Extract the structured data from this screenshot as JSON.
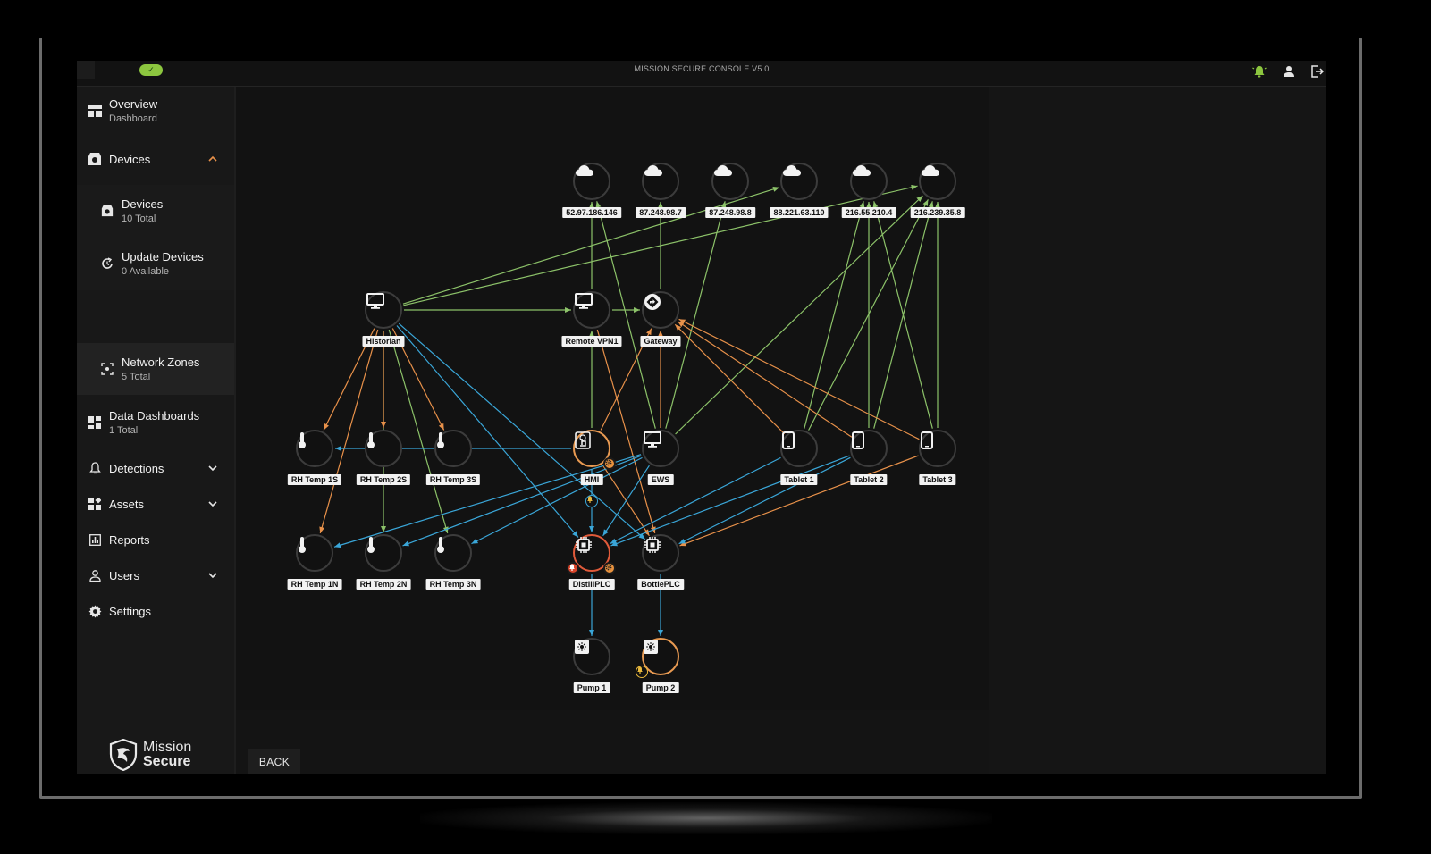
{
  "header": {
    "title": "MISSION SECURE CONSOLE V5.0",
    "status_check": "✓"
  },
  "sidebar": {
    "items": [
      {
        "label": "Overview",
        "sub": "Dashboard",
        "icon": "dashboard-icon"
      },
      {
        "label": "Devices",
        "sub": "",
        "icon": "device-icon",
        "expanded": true
      },
      {
        "label": "Devices",
        "sub": "10 Total",
        "icon": "device-icon"
      },
      {
        "label": "Update Devices",
        "sub": "0 Available",
        "icon": "refresh-icon"
      },
      {
        "label": "Network Zones",
        "sub": "5 Total",
        "icon": "zone-icon",
        "active": true
      },
      {
        "label": "Data Dashboards",
        "sub": "1 Total",
        "icon": "grid-icon"
      },
      {
        "label": "Detections",
        "sub": "",
        "icon": "bell-icon"
      },
      {
        "label": "Assets",
        "sub": "",
        "icon": "assets-icon"
      },
      {
        "label": "Reports",
        "sub": "",
        "icon": "reports-icon"
      },
      {
        "label": "Users",
        "sub": "",
        "icon": "user-icon"
      },
      {
        "label": "Settings",
        "sub": "",
        "icon": "gear-icon"
      }
    ],
    "logo": {
      "line1": "Mission",
      "line2": "Secure"
    }
  },
  "footer": {
    "back_label": "BACK"
  },
  "colors": {
    "green_edge": "#8cc269",
    "orange_edge": "#e8914a",
    "blue_edge": "#3aa6d8",
    "alert_red": "#e05a3a",
    "warn_orange": "#e89a52"
  },
  "network": {
    "nodes": [
      {
        "id": "c1",
        "label": "52.97.186.146",
        "type": "cloud"
      },
      {
        "id": "c2",
        "label": "87.248.98.7",
        "type": "cloud"
      },
      {
        "id": "c3",
        "label": "87.248.98.8",
        "type": "cloud"
      },
      {
        "id": "c4",
        "label": "88.221.63.110",
        "type": "cloud"
      },
      {
        "id": "c5",
        "label": "216.55.210.4",
        "type": "cloud"
      },
      {
        "id": "c6",
        "label": "216.239.35.8",
        "type": "cloud"
      },
      {
        "id": "hist",
        "label": "Historian",
        "type": "monitor"
      },
      {
        "id": "vpn",
        "label": "Remote VPN1",
        "type": "monitor"
      },
      {
        "id": "gw",
        "label": "Gateway",
        "type": "gateway"
      },
      {
        "id": "t1s",
        "label": "RH Temp 1S",
        "type": "thermo"
      },
      {
        "id": "t2s",
        "label": "RH Temp 2S",
        "type": "thermo"
      },
      {
        "id": "t3s",
        "label": "RH Temp 3S",
        "type": "thermo"
      },
      {
        "id": "hmi",
        "label": "HMI",
        "type": "touch",
        "status": "warn"
      },
      {
        "id": "ews",
        "label": "EWS",
        "type": "monitor"
      },
      {
        "id": "tab1",
        "label": "Tablet 1",
        "type": "tablet"
      },
      {
        "id": "tab2",
        "label": "Tablet 2",
        "type": "tablet"
      },
      {
        "id": "tab3",
        "label": "Tablet 3",
        "type": "tablet"
      },
      {
        "id": "t1n",
        "label": "RH Temp 1N",
        "type": "thermo"
      },
      {
        "id": "t2n",
        "label": "RH Temp 2N",
        "type": "thermo"
      },
      {
        "id": "t3n",
        "label": "RH Temp 3N",
        "type": "thermo"
      },
      {
        "id": "dplc",
        "label": "DistillPLC",
        "type": "chip",
        "status": "alert"
      },
      {
        "id": "bplc",
        "label": "BottlePLC",
        "type": "chip"
      },
      {
        "id": "p1",
        "label": "Pump 1",
        "type": "pump"
      },
      {
        "id": "p2",
        "label": "Pump 2",
        "type": "pump",
        "status": "warn"
      }
    ],
    "edges": [
      {
        "from": "hist",
        "to": "c4",
        "color": "green"
      },
      {
        "from": "hist",
        "to": "c6",
        "color": "green"
      },
      {
        "from": "hist",
        "to": "vpn",
        "color": "green"
      },
      {
        "from": "vpn",
        "to": "gw",
        "color": "green"
      },
      {
        "from": "vpn",
        "to": "c1",
        "color": "green"
      },
      {
        "from": "gw",
        "to": "c2",
        "color": "green"
      },
      {
        "from": "hmi",
        "to": "vpn",
        "color": "green"
      },
      {
        "from": "ews",
        "to": "c1",
        "color": "green"
      },
      {
        "from": "ews",
        "to": "c3",
        "color": "green"
      },
      {
        "from": "ews",
        "to": "c6",
        "color": "green"
      },
      {
        "from": "tab1",
        "to": "c5",
        "color": "green"
      },
      {
        "from": "tab1",
        "to": "c6",
        "color": "green"
      },
      {
        "from": "tab2",
        "to": "c5",
        "color": "green"
      },
      {
        "from": "tab2",
        "to": "c6",
        "color": "green"
      },
      {
        "from": "tab3",
        "to": "c5",
        "color": "green"
      },
      {
        "from": "tab3",
        "to": "c6",
        "color": "green"
      },
      {
        "from": "hist",
        "to": "t2n",
        "color": "green"
      },
      {
        "from": "hist",
        "to": "t3n",
        "color": "green"
      },
      {
        "from": "hmi",
        "to": "gw",
        "color": "orange"
      },
      {
        "from": "ews",
        "to": "gw",
        "color": "orange"
      },
      {
        "from": "tab1",
        "to": "gw",
        "color": "orange"
      },
      {
        "from": "tab2",
        "to": "gw",
        "color": "orange"
      },
      {
        "from": "tab3",
        "to": "gw",
        "color": "orange"
      },
      {
        "from": "hist",
        "to": "t1s",
        "color": "orange"
      },
      {
        "from": "hist",
        "to": "t2s",
        "color": "orange"
      },
      {
        "from": "hist",
        "to": "t3s",
        "color": "orange"
      },
      {
        "from": "hist",
        "to": "t1n",
        "color": "orange"
      },
      {
        "from": "hmi",
        "to": "bplc",
        "color": "orange"
      },
      {
        "from": "tab3",
        "to": "bplc",
        "color": "orange"
      },
      {
        "from": "vpn",
        "to": "bplc",
        "color": "orange"
      },
      {
        "from": "hmi",
        "to": "t1s",
        "color": "blue"
      },
      {
        "from": "hmi",
        "to": "dplc",
        "color": "blue"
      },
      {
        "from": "hist",
        "to": "dplc",
        "color": "blue"
      },
      {
        "from": "hist",
        "to": "bplc",
        "color": "blue"
      },
      {
        "from": "ews",
        "to": "t1n",
        "color": "blue"
      },
      {
        "from": "ews",
        "to": "t2n",
        "color": "blue"
      },
      {
        "from": "ews",
        "to": "t3n",
        "color": "blue"
      },
      {
        "from": "ews",
        "to": "dplc",
        "color": "blue"
      },
      {
        "from": "tab1",
        "to": "dplc",
        "color": "blue"
      },
      {
        "from": "tab2",
        "to": "bplc",
        "color": "blue"
      },
      {
        "from": "tab2",
        "to": "dplc",
        "color": "blue"
      },
      {
        "from": "dplc",
        "to": "p1",
        "color": "blue"
      },
      {
        "from": "bplc",
        "to": "p2",
        "color": "blue"
      }
    ]
  }
}
